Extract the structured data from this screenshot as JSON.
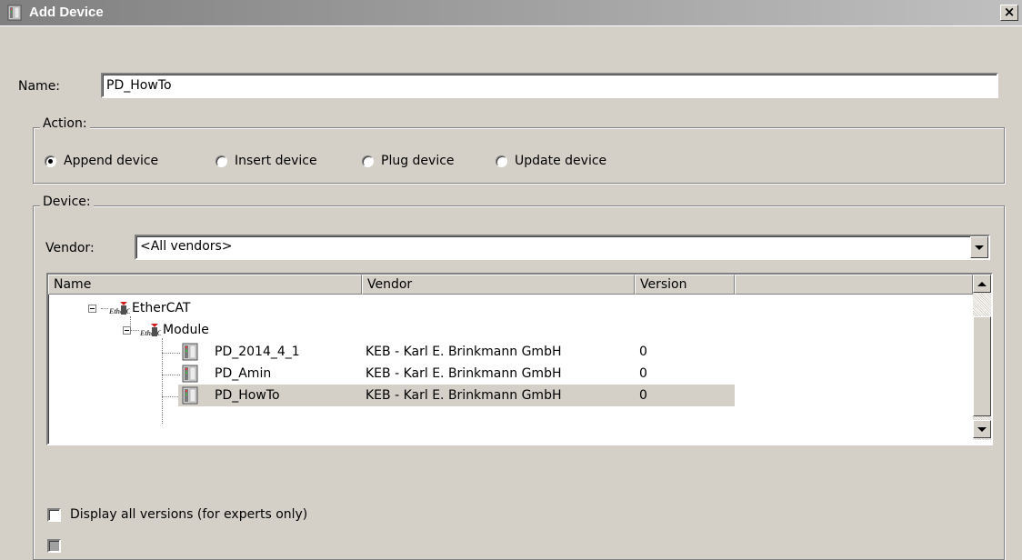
{
  "window": {
    "title": "Add Device"
  },
  "name_field": {
    "label": "Name:",
    "value": "PD_HowTo"
  },
  "action": {
    "legend": "Action:",
    "options": [
      {
        "label": "Append device",
        "checked": true
      },
      {
        "label": "Insert device",
        "checked": false
      },
      {
        "label": "Plug device",
        "checked": false
      },
      {
        "label": "Update device",
        "checked": false
      }
    ]
  },
  "device": {
    "legend": "Device:",
    "vendor_label": "Vendor:",
    "vendor_value": "<All vendors>",
    "columns": [
      "Name",
      "Vendor",
      "Version"
    ],
    "tree": [
      {
        "name": "EtherCAT",
        "icon": "ethercat-icon"
      },
      {
        "name": "Module",
        "icon": "ethercat-icon"
      },
      {
        "name": "PD_2014_4_1",
        "vendor": "KEB - Karl E. Brinkmann GmbH",
        "version": "0",
        "icon": "device-icon"
      },
      {
        "name": "PD_Amin",
        "vendor": "KEB - Karl E. Brinkmann GmbH",
        "version": "0",
        "icon": "device-icon"
      },
      {
        "name": "PD_HowTo",
        "vendor": "KEB - Karl E. Brinkmann GmbH",
        "version": "0",
        "icon": "device-icon",
        "selected": true
      }
    ],
    "display_all_versions": {
      "label": "Display all versions (for experts only)",
      "checked": false
    }
  },
  "colors": {
    "dialog_bg": "#d4d0c8",
    "title_gradient_start": "#808080",
    "title_gradient_end": "#c0c0c0"
  }
}
